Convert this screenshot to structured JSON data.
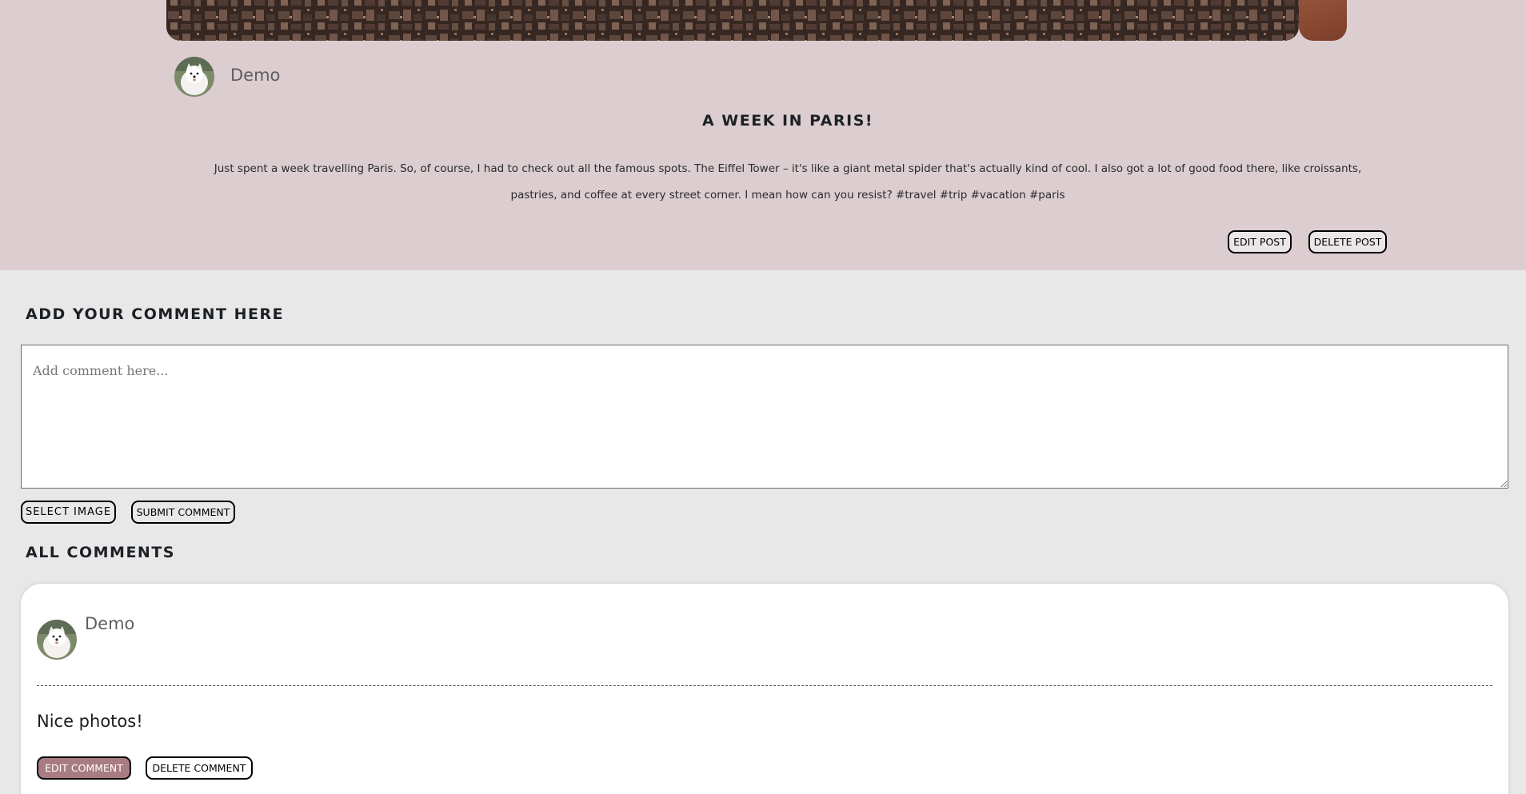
{
  "post": {
    "author": "Demo",
    "title": "A WEEK IN PARIS!",
    "body": "Just spent a week travelling Paris. So, of course, I had to check out all the famous spots. The Eiffel Tower – it's like a giant metal spider that's actually kind of cool. I also got a lot of good food there, like croissants, pastries, and coffee at every street corner. I mean how can you resist? #travel #trip #vacation #paris",
    "edit_label": "EDIT POST",
    "delete_label": "DELETE POST"
  },
  "comment_form": {
    "heading": "ADD YOUR COMMENT HERE",
    "placeholder": "Add comment here...",
    "value": "",
    "select_image_label": "SELECT IMAGE",
    "submit_label": "SUBMIT COMMENT"
  },
  "comments_section": {
    "heading": "ALL COMMENTS",
    "comments": [
      {
        "author": "Demo",
        "text": "Nice photos!",
        "edit_label": "EDIT COMMENT",
        "delete_label": "DELETE COMMENT"
      }
    ]
  },
  "colors": {
    "post_background": "#dbcdd0",
    "page_background": "#e8e8e8",
    "edit_comment_button": "#a87c82"
  },
  "icons": {
    "avatar": "samoyed-dog-avatar",
    "post_photo": "paris-rooftops-photo"
  }
}
